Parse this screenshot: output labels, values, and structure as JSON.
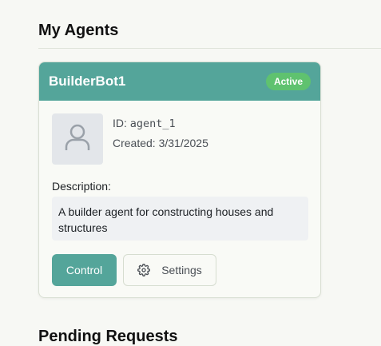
{
  "agents_section": {
    "title": "My Agents"
  },
  "agent_card": {
    "name": "BuilderBot1",
    "status": "Active",
    "id_label": "ID: ",
    "id_value": "agent_1",
    "created_label": "Created: ",
    "created_value": "3/31/2025",
    "description_label": "Description:",
    "description": "A builder agent for constructing houses and structures",
    "control_label": "Control",
    "settings_label": "Settings",
    "avatar_icon": "user-icon",
    "settings_icon": "gear-icon"
  },
  "pending_section": {
    "title": "Pending Requests"
  },
  "colors": {
    "accent": "#54a59a",
    "badge": "#5fc26f",
    "background": "#f7f8f4"
  }
}
